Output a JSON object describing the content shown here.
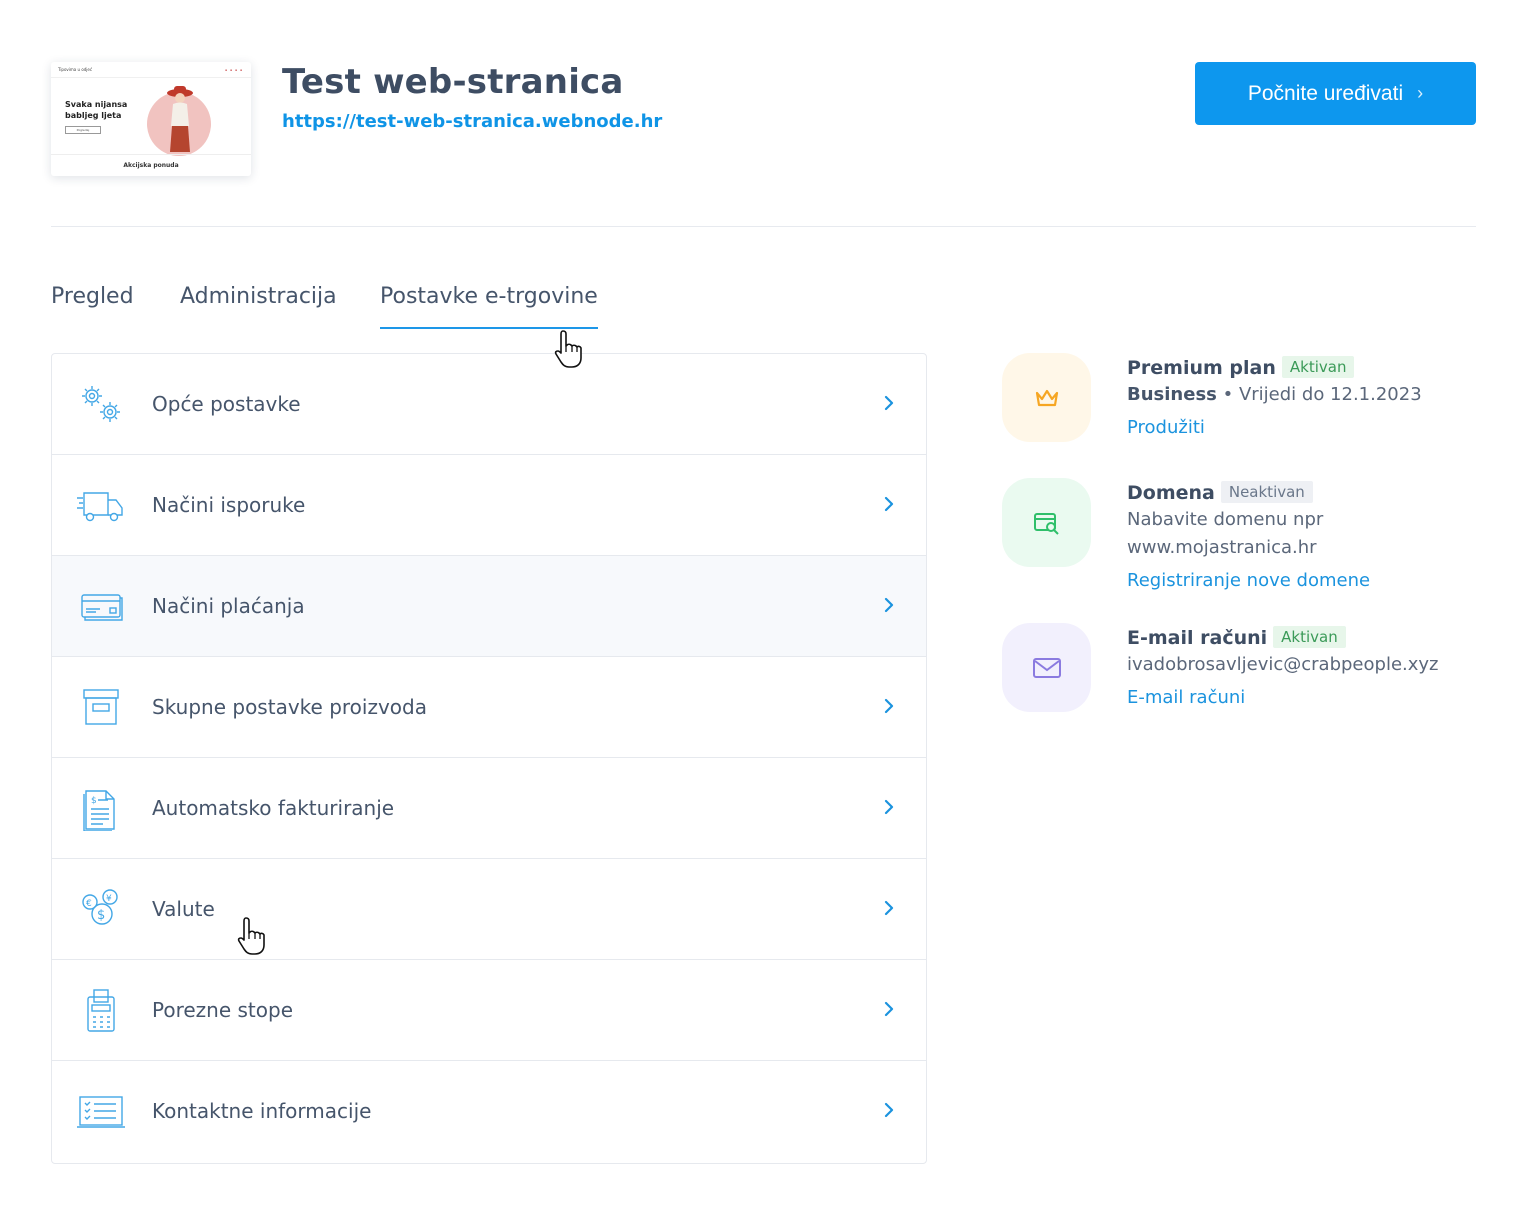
{
  "header": {
    "site_title": "Test web-stranica",
    "site_url": "https://test-web-stranica.webnode.hr",
    "edit_button": "Počnite uređivati",
    "thumbnail": {
      "logo": "Tipovima u odjeć",
      "headline": "Svaka nijansa babljeg ljeta",
      "button": "Pogledaj",
      "footer": "Akcijska ponuda"
    }
  },
  "tabs": [
    {
      "label": "Pregled"
    },
    {
      "label": "Administracija"
    },
    {
      "label": "Postavke e-trgovine"
    }
  ],
  "active_tab": "Postavke e-trgovine",
  "settings_items": [
    {
      "label": "Opće postavke",
      "icon": "gears-icon"
    },
    {
      "label": "Načini isporuke",
      "icon": "delivery-truck-icon"
    },
    {
      "label": "Načini plaćanja",
      "icon": "payment-card-icon"
    },
    {
      "label": "Skupne postavke proizvoda",
      "icon": "product-box-icon"
    },
    {
      "label": "Automatsko fakturiranje",
      "icon": "invoice-document-icon"
    },
    {
      "label": "Valute",
      "icon": "currency-coins-icon"
    },
    {
      "label": "Porezne stope",
      "icon": "calculator-icon"
    },
    {
      "label": "Kontaktne informacije",
      "icon": "contact-checklist-icon"
    }
  ],
  "services": {
    "premium": {
      "title": "Premium plan",
      "status": "Aktivan",
      "plan": "Business",
      "validity": "• Vrijedi do 12.1.2023",
      "link": "Produžiti",
      "icon": "crown-icon",
      "color": "#f6a623",
      "bg": "#fff7e8"
    },
    "domain": {
      "title": "Domena",
      "status": "Neaktivan",
      "line1": "Nabavite domenu npr",
      "line2": "www.mojastranica.hr",
      "link": "Registriranje nove domene",
      "icon": "domain-search-icon",
      "color": "#2fbf6a",
      "bg": "#eafaf0"
    },
    "email": {
      "title": "E-mail računi",
      "status": "Aktivan",
      "address": "ivadobrosavljevic@crabpeople.xyz",
      "link": "E-mail računi",
      "icon": "envelope-icon",
      "color": "#8b7be0",
      "bg": "#f2f0fd"
    }
  },
  "colors": {
    "accent": "#0d97ee",
    "link": "#1b93de",
    "text": "#46556b"
  }
}
